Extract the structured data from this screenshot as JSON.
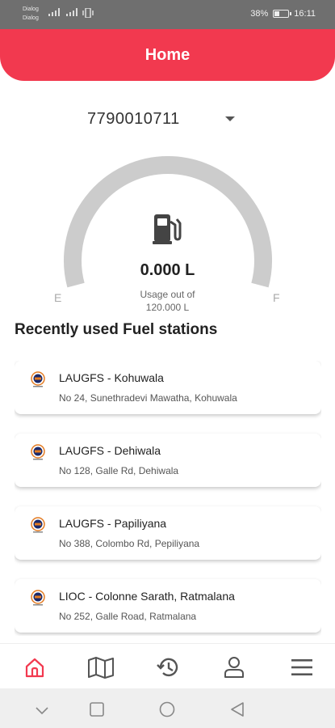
{
  "status_bar": {
    "carrier_1": "Dialog",
    "carrier_2": "Dialog",
    "battery": "38%",
    "battery_level": 0.38,
    "time": "16:11"
  },
  "header": {
    "title": "Home"
  },
  "account": {
    "number": "7790010711"
  },
  "gauge": {
    "value": "0.000 L",
    "label_line1": "Usage out of",
    "label_line2": "120.000 L",
    "empty_label": "E",
    "full_label": "F",
    "usage_fraction": 0.0
  },
  "section": {
    "title": "Recently used Fuel stations"
  },
  "stations": [
    {
      "name": "LAUGFS - Kohuwala",
      "address": "No 24, Sunethradevi Mawatha, Kohuwala",
      "logo": "fuel-brand-logo-icon"
    },
    {
      "name": "LAUGFS - Dehiwala",
      "address": "No 128, Galle Rd, Dehiwala",
      "logo": "fuel-brand-logo-icon"
    },
    {
      "name": "LAUGFS - Papiliyana",
      "address": "No 388, Colombo Rd, Pepiliyana",
      "logo": "fuel-brand-logo-icon"
    },
    {
      "name": "LIOC - Colonne Sarath, Ratmalana",
      "address": "No 252, Galle Road, Ratmalana",
      "logo": "fuel-brand-logo-icon"
    }
  ],
  "bottom_nav": {
    "items": [
      {
        "icon": "home-icon",
        "active": true
      },
      {
        "icon": "map-icon",
        "active": false
      },
      {
        "icon": "history-icon",
        "active": false
      },
      {
        "icon": "profile-icon",
        "active": false
      },
      {
        "icon": "menu-icon",
        "active": false
      }
    ]
  },
  "colors": {
    "accent": "#f2394f",
    "gauge_track": "#cccccc",
    "nav_active": "#f2394f",
    "nav_inactive": "#555555"
  }
}
